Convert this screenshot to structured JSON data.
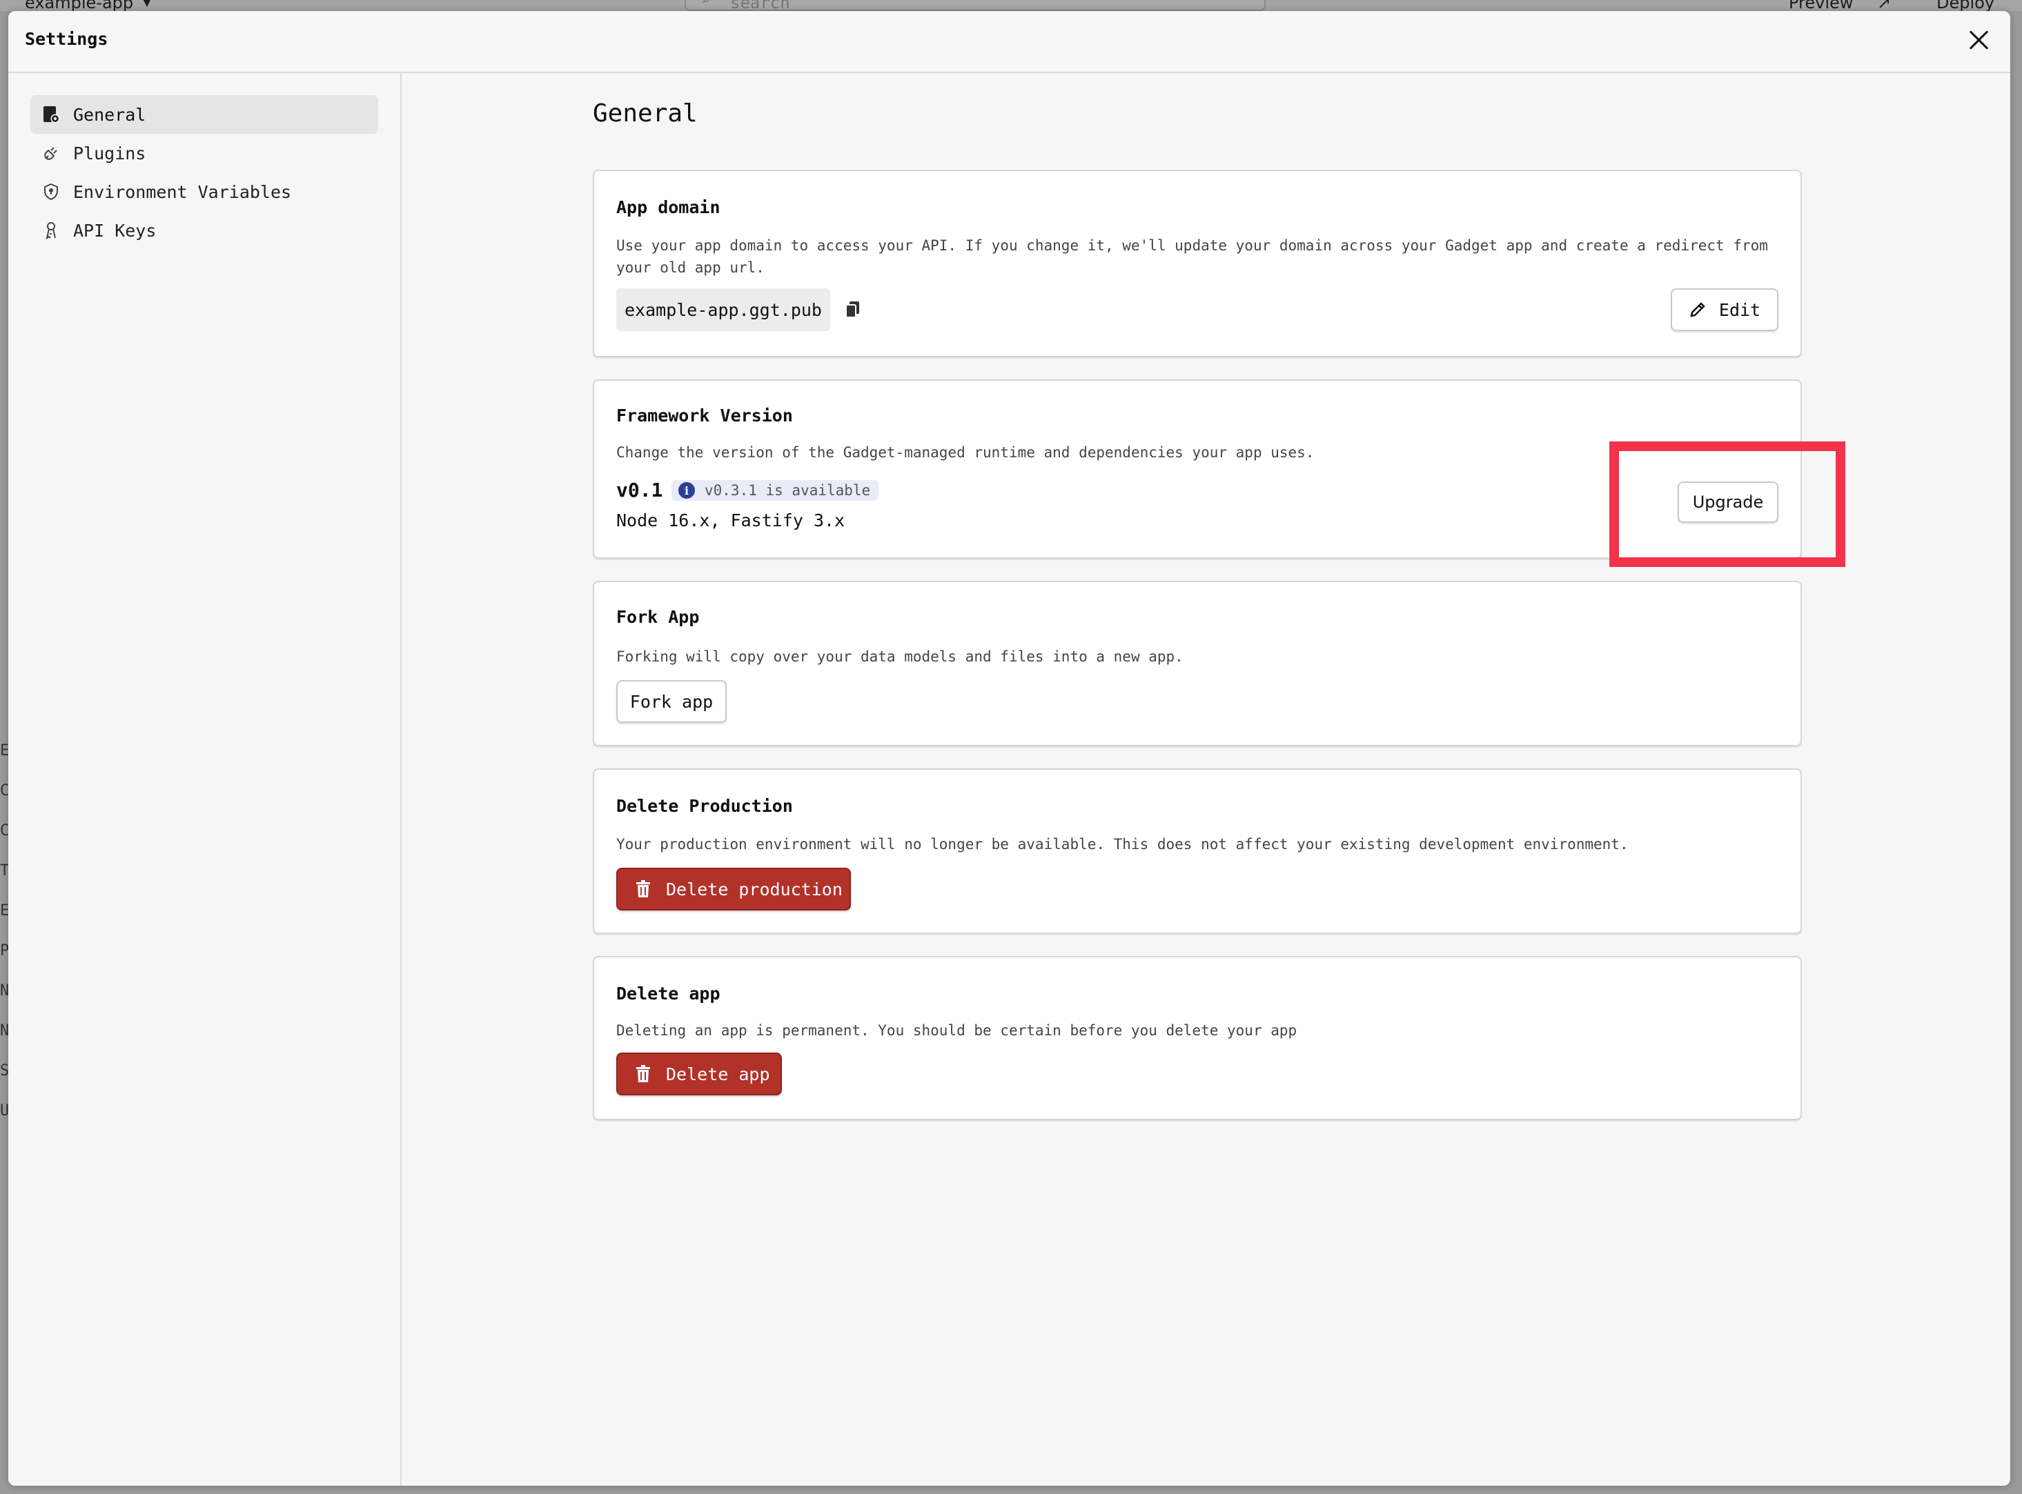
{
  "background": {
    "app_name": "example-app",
    "search_placeholder": "search",
    "preview_label": "Preview",
    "deploy_label": "Deploy"
  },
  "modal": {
    "title": "Settings"
  },
  "sidebar": {
    "items": [
      {
        "label": "General",
        "icon": "settings-page-icon",
        "active": true
      },
      {
        "label": "Plugins",
        "icon": "plug-icon",
        "active": false
      },
      {
        "label": "Environment Variables",
        "icon": "shield-icon",
        "active": false
      },
      {
        "label": "API Keys",
        "icon": "key-icon",
        "active": false
      }
    ]
  },
  "main": {
    "title": "General",
    "app_domain": {
      "title": "App domain",
      "description": "Use your app domain to access your API. If you change it, we'll update your domain across your Gadget app and create a redirect from your old app url.",
      "domain": "example-app.ggt.pub",
      "edit_label": "Edit"
    },
    "framework": {
      "title": "Framework Version",
      "description": "Change the version of the Gadget-managed runtime and dependencies your app uses.",
      "version": "v0.1",
      "available_badge": "v0.3.1 is available",
      "runtime": "Node 16.x, Fastify 3.x",
      "upgrade_label": "Upgrade"
    },
    "fork": {
      "title": "Fork App",
      "description": "Forking will copy over your data models and files into a new app.",
      "button_label": "Fork app"
    },
    "delete_production": {
      "title": "Delete Production",
      "description": "Your production environment will no longer be available. This does not affect your existing development environment.",
      "button_label": "Delete production"
    },
    "delete_app": {
      "title": "Delete app",
      "description": "Deleting an app is permanent. You should be certain before you delete your app",
      "button_label": "Delete app"
    }
  },
  "colors": {
    "danger": "#b23129",
    "highlight": "#f2334b",
    "info_badge": "#2b3f97"
  }
}
